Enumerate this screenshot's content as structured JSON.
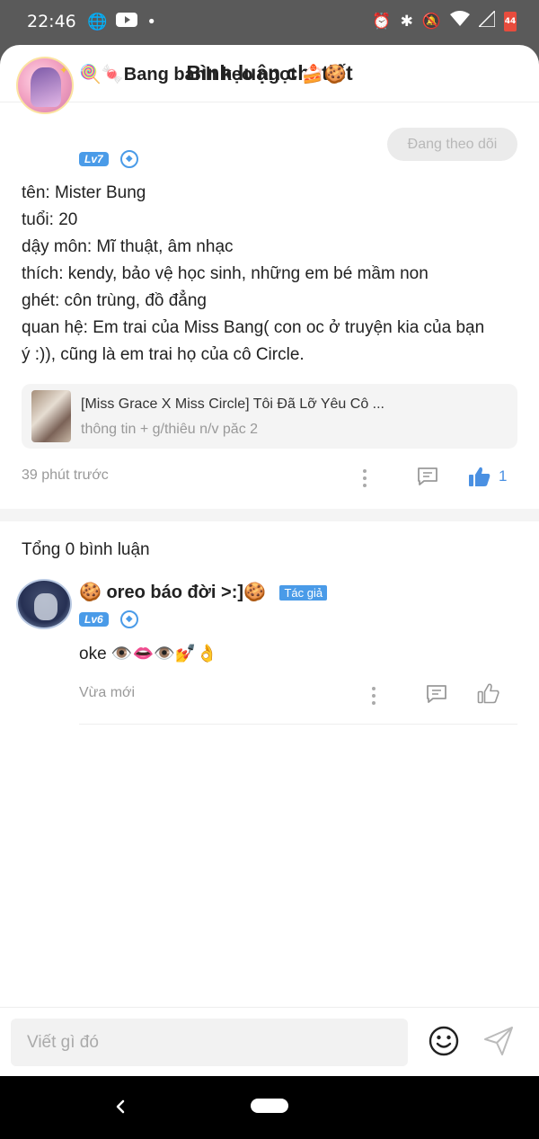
{
  "status_bar": {
    "time": "22:46",
    "battery": "44"
  },
  "header": {
    "title": "Bình luận chi tiết"
  },
  "post": {
    "username": "🍭🍬Bang bánh kẹo ngọt 🍰🍪",
    "level": "Lv7",
    "follow_label": "Đang theo dõi",
    "bio_lines": [
      "tên: Mister Bung",
      "tuổi: 20",
      "dậy môn: Mĩ thuật, âm nhạc",
      "thích: kendy, bảo vệ học sinh, những em bé mầm non",
      "ghét: côn trùng, đồ đẳng",
      "quan hệ: Em trai của Miss Bang( con oc ở truyện kia của bạn",
      "ý :)), cũng là em trai họ của cô Circle."
    ],
    "story": {
      "title": "[Miss Grace X Miss Circle] Tôi Đã Lỡ Yêu Cô ...",
      "subtitle": "thông tin + g/thiêu n/v păc 2"
    },
    "time": "39 phút trước",
    "like_count": "1"
  },
  "comments": {
    "total_label": "Tổng 0 bình luận",
    "items": [
      {
        "username": "🍪 oreo báo đời >:]🍪",
        "author_badge": "Tác giả",
        "level": "Lv6",
        "text": "oke 👁️👄👁️💅👌",
        "time": "Vừa mới"
      }
    ]
  },
  "input": {
    "placeholder": "Viết gì đó"
  },
  "colors": {
    "accent": "#4a9be8",
    "like": "#4a90e2",
    "muted": "#999999"
  }
}
